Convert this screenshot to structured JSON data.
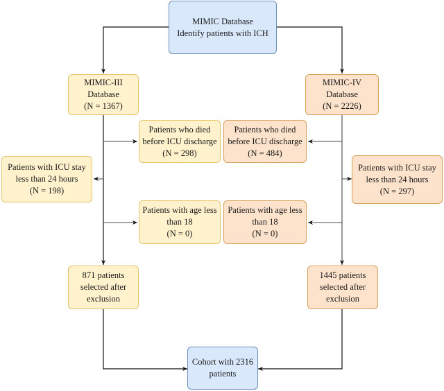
{
  "diagram": {
    "type": "flowchart",
    "nodes": {
      "source": {
        "lines": [
          "MIMIC Database",
          "Identify patients with ICH"
        ],
        "color": "#dae8fc"
      },
      "mimic3": {
        "lines": [
          "MIMIC-III",
          "Database",
          "(N = 1367)"
        ],
        "color": "#fff2cc"
      },
      "mimic4": {
        "lines": [
          "MIMIC-IV",
          "Database",
          "(N = 2226)"
        ],
        "color": "#fde3cc"
      },
      "died3": {
        "lines": [
          "Patients who died",
          "before ICU discharge",
          "(N = 298)"
        ],
        "color": "#fff2cc"
      },
      "died4": {
        "lines": [
          "Patients who died",
          "before ICU discharge",
          "(N = 484)"
        ],
        "color": "#fde3cc"
      },
      "stay3": {
        "lines": [
          "Patients with ICU stay",
          "less than 24 hours",
          "(N = 198)"
        ],
        "color": "#fff2cc"
      },
      "stay4": {
        "lines": [
          "Patients with ICU stay",
          "less than 24 hours",
          "(N = 297)"
        ],
        "color": "#fde3cc"
      },
      "age3": {
        "lines": [
          "Patients with age less",
          "than 18",
          "(N = 0)"
        ],
        "color": "#fff2cc"
      },
      "age4": {
        "lines": [
          "Patients with age less",
          "than 18",
          "(N = 0)"
        ],
        "color": "#fde3cc"
      },
      "selected3": {
        "lines": [
          "871 patients",
          "selected after",
          "exclusion"
        ],
        "color": "#fff2cc"
      },
      "selected4": {
        "lines": [
          "1445 patients",
          "selected after",
          "exclusion"
        ],
        "color": "#fde3cc"
      },
      "cohort": {
        "lines": [
          "Cohort with 2316",
          "patients"
        ],
        "color": "#dae8fc"
      }
    },
    "edges": [
      [
        "source",
        "mimic3"
      ],
      [
        "source",
        "mimic4"
      ],
      [
        "mimic3",
        "died3"
      ],
      [
        "mimic3",
        "stay3"
      ],
      [
        "mimic3",
        "age3"
      ],
      [
        "mimic3",
        "selected3"
      ],
      [
        "mimic4",
        "died4"
      ],
      [
        "mimic4",
        "stay4"
      ],
      [
        "mimic4",
        "age4"
      ],
      [
        "mimic4",
        "selected4"
      ],
      [
        "selected3",
        "cohort"
      ],
      [
        "selected4",
        "cohort"
      ]
    ]
  }
}
